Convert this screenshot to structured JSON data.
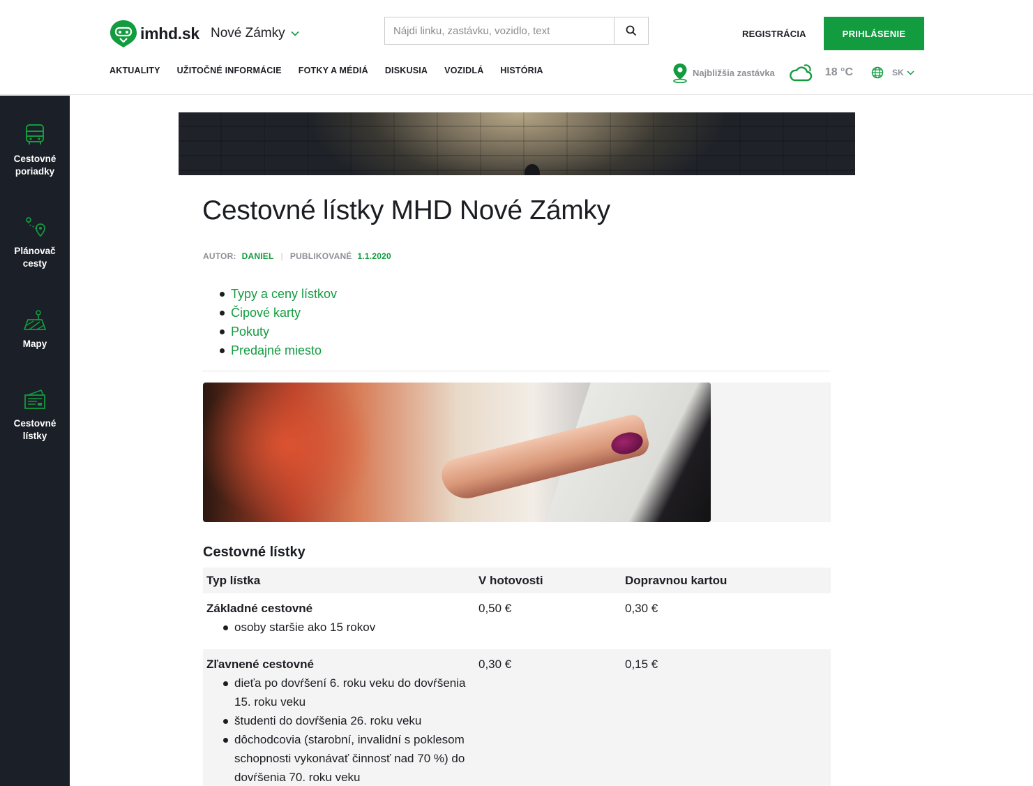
{
  "header": {
    "logo_text": "imhd",
    "logo_tld": ".sk",
    "city": "Nové Zámky",
    "search_placeholder": "Nájdi linku, zastávku, vozidlo, text",
    "register_label": "REGISTRÁCIA",
    "login_label": "PRIHLÁSENIE",
    "nav": [
      "AKTUALITY",
      "UŽITOČNÉ INFORMÁCIE",
      "FOTKY A MÉDIÁ",
      "DISKUSIA",
      "VOZIDLÁ",
      "HISTÓRIA"
    ],
    "nearest_stop_label": "Najbližšia zastávka",
    "temperature": "18 °C",
    "language": "SK",
    "icons": [
      "search-icon",
      "location-pin-icon",
      "cloud-sun-icon",
      "globe-icon",
      "chevron-down-icon"
    ]
  },
  "sidebar": {
    "items": [
      {
        "line1": "Cestovné",
        "line2": "poriadky",
        "icon": "bus-icon"
      },
      {
        "line1": "Plánovač",
        "line2": "cesty",
        "icon": "route-planner-icon"
      },
      {
        "line1": "Mapy",
        "line2": "",
        "icon": "map-icon"
      },
      {
        "line1": "Cestovné",
        "line2": "lístky",
        "icon": "ticket-icon"
      }
    ]
  },
  "article": {
    "title": "Cestovné lístky MHD Nové Zámky",
    "author_label": "AUTOR:",
    "author": "DANIEL",
    "published_label": "PUBLIKOVANÉ",
    "published_date": "1.1.2020",
    "toc": [
      "Typy a ceny lístkov",
      "Čipové karty",
      "Pokuty",
      "Predajné miesto"
    ]
  },
  "tickets": {
    "section_title": "Cestovné lístky",
    "headers": [
      "Typ lístka",
      "V hotovosti",
      "Dopravnou kartou"
    ],
    "rows": [
      {
        "type": "Základné cestovné",
        "notes": [
          "osoby staršie ako 15 rokov"
        ],
        "cash": "0,50 €",
        "card": "0,30 €"
      },
      {
        "type": "Zľavnené cestovné",
        "notes": [
          "dieťa po dovŕšení 6. roku veku do dovŕšenia 15. roku veku",
          "študenti do dovŕšenia 26. roku veku",
          "dôchodcovia (starobní, invalidní s poklesom schopnosti vykonávať činnosť nad 70 %) do dovŕšenia 70. roku veku"
        ],
        "cash": "0,30 €",
        "card": "0,15 €"
      }
    ]
  },
  "colors": {
    "brand_green": "#129b3f",
    "sidebar_bg": "#1b1f27",
    "muted_text": "#8d9096"
  }
}
